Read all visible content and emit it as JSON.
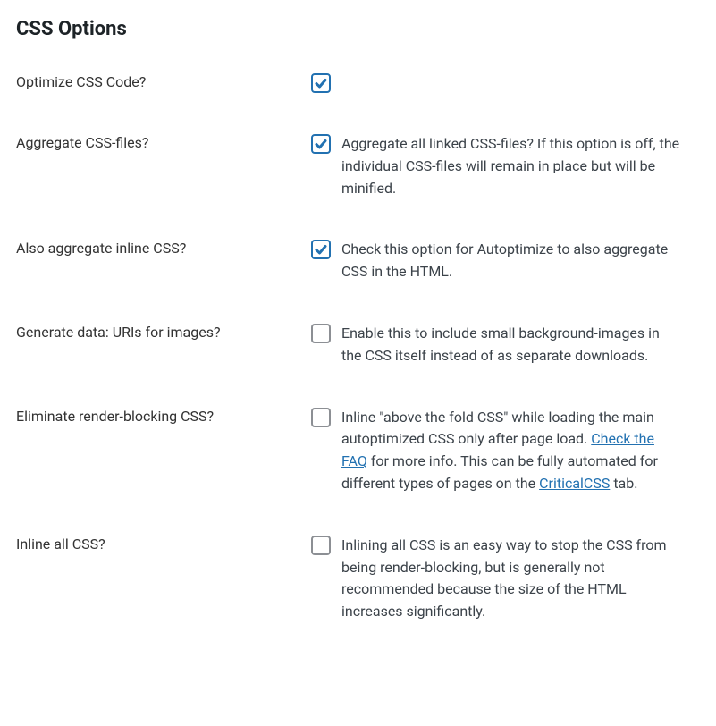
{
  "section_title": "CSS Options",
  "options": {
    "optimize": {
      "label": "Optimize CSS Code?",
      "checked": true,
      "description": ""
    },
    "aggregate": {
      "label": "Aggregate CSS-files?",
      "checked": true,
      "description": "Aggregate all linked CSS-files? If this option is off, the individual CSS-files will remain in place but will be minified."
    },
    "aggregate_inline": {
      "label": "Also aggregate inline CSS?",
      "checked": true,
      "description": "Check this option for Autoptimize to also aggregate CSS in the HTML."
    },
    "data_uris": {
      "label": "Generate data: URIs for images?",
      "checked": false,
      "description": "Enable this to include small background-images in the CSS itself instead of as separate downloads."
    },
    "eliminate_render_blocking": {
      "label": "Eliminate render-blocking CSS?",
      "checked": false,
      "desc_part1": "Inline \"above the fold CSS\" while loading the main autoptimized CSS only after page load. ",
      "link1_text": "Check the FAQ",
      "desc_part2": " for more info. This can be fully automated for different types of pages on the ",
      "link2_text": "CriticalCSS",
      "desc_part3": " tab."
    },
    "inline_all": {
      "label": "Inline all CSS?",
      "checked": false,
      "description": "Inlining all CSS is an easy way to stop the CSS from being render-blocking, but is generally not recommended because the size of the HTML increases significantly."
    }
  }
}
